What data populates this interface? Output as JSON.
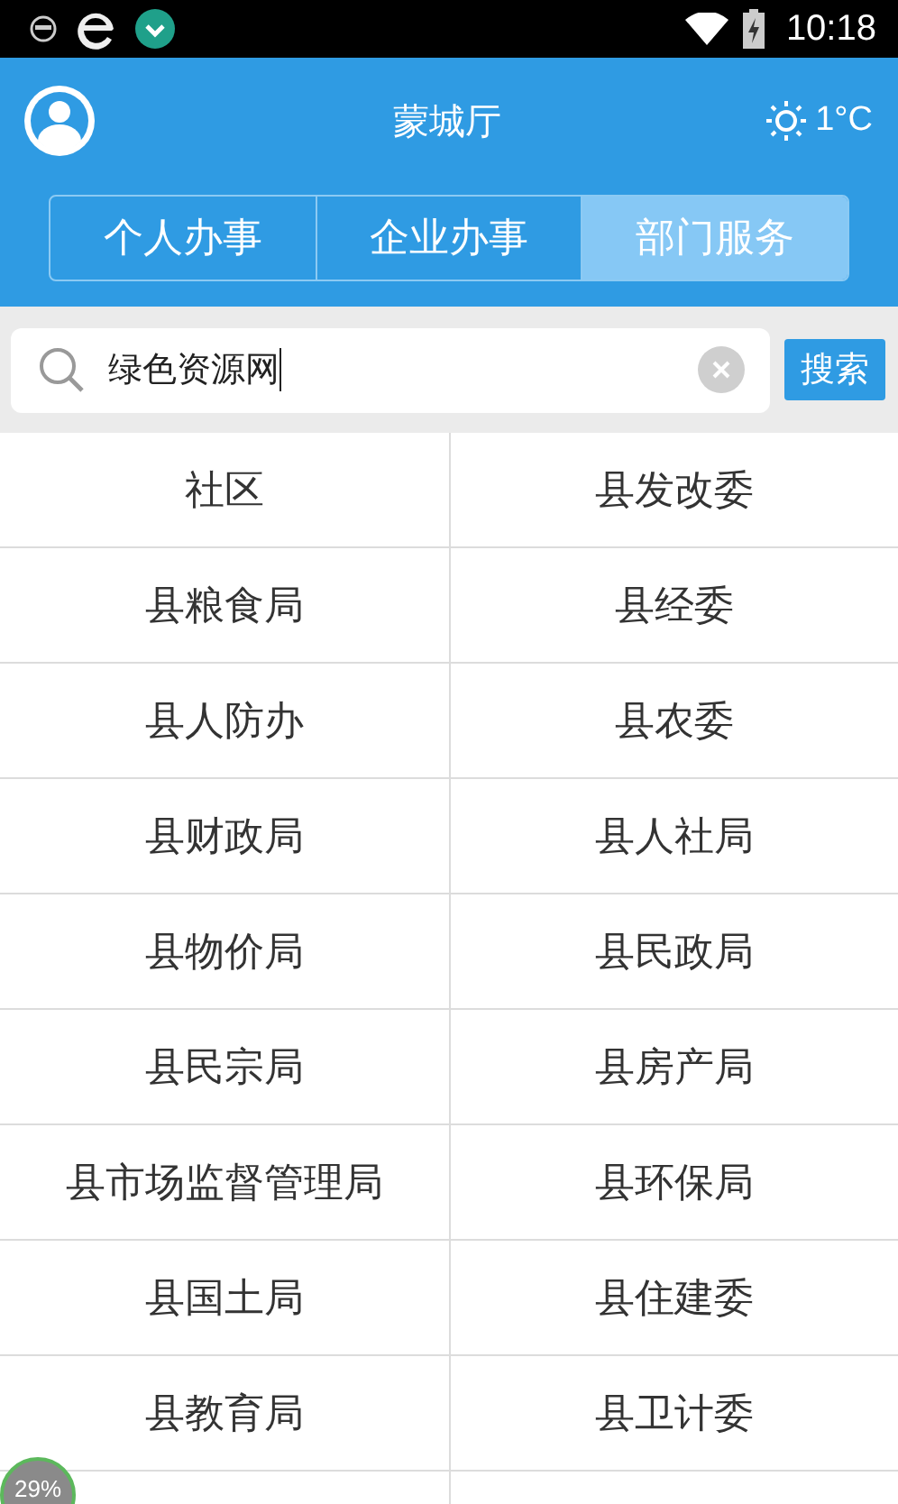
{
  "status_bar": {
    "time": "10:18"
  },
  "header": {
    "title": "蒙城厅",
    "weather": "1°C"
  },
  "tabs": [
    {
      "label": "个人办事",
      "selected": false
    },
    {
      "label": "企业办事",
      "selected": false
    },
    {
      "label": "部门服务",
      "selected": true
    }
  ],
  "search": {
    "value": "绿色资源网",
    "button": "搜索"
  },
  "departments": [
    [
      "社区",
      "县发改委"
    ],
    [
      "县粮食局",
      "县经委"
    ],
    [
      "县人防办",
      "县农委"
    ],
    [
      "县财政局",
      "县人社局"
    ],
    [
      "县物价局",
      "县民政局"
    ],
    [
      "县民宗局",
      "县房产局"
    ],
    [
      "县市场监督管理局",
      "县环保局"
    ],
    [
      "县国土局",
      "县住建委"
    ],
    [
      "县教育局",
      "县卫计委"
    ]
  ],
  "floating_ball": {
    "text": "29%"
  }
}
